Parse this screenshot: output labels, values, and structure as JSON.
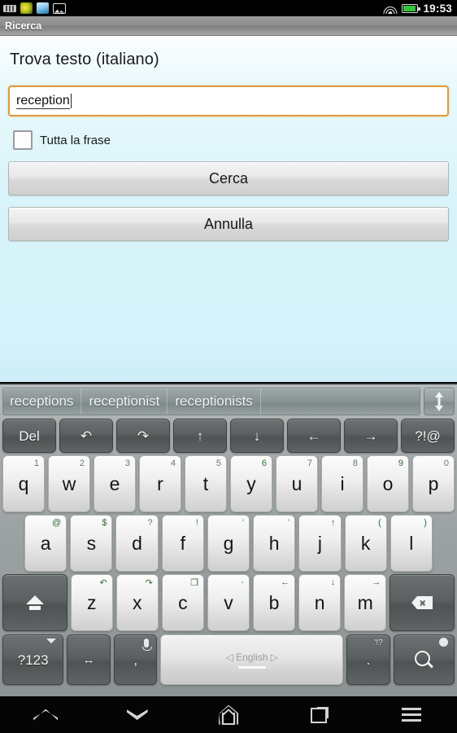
{
  "statusbar": {
    "icons": [
      "keyboard-icon",
      "app-yellow-icon",
      "app-blue-icon",
      "picture-icon"
    ],
    "wifi": "wifi-icon",
    "battery": "battery-icon",
    "time": "19:53"
  },
  "titlebar": {
    "title": "Ricerca"
  },
  "dialog": {
    "heading": "Trova testo (italiano)",
    "search_input": {
      "value": "reception",
      "placeholder": ""
    },
    "checkbox": {
      "label": "Tutta la frase",
      "checked": false
    },
    "search_button": "Cerca",
    "cancel_button": "Annulla"
  },
  "keyboard": {
    "suggestions": [
      "receptions",
      "receptionist",
      "receptionists"
    ],
    "expand_icon": "up-down-arrow-icon",
    "function_row": [
      {
        "label": "Del",
        "icon": ""
      },
      {
        "label": "↶",
        "icon": "undo-icon"
      },
      {
        "label": "↷",
        "icon": "redo-icon"
      },
      {
        "label": "↑",
        "icon": "arrow-up-icon"
      },
      {
        "label": "↓",
        "icon": "arrow-down-icon"
      },
      {
        "label": "←",
        "icon": "arrow-left-icon"
      },
      {
        "label": "→",
        "icon": "arrow-right-icon"
      },
      {
        "label": "?!@",
        "icon": ""
      }
    ],
    "row1": [
      {
        "key": "q",
        "alt": "1"
      },
      {
        "key": "w",
        "alt": "2"
      },
      {
        "key": "e",
        "alt": "3"
      },
      {
        "key": "r",
        "alt": "4"
      },
      {
        "key": "t",
        "alt": "5"
      },
      {
        "key": "y",
        "alt": "6"
      },
      {
        "key": "u",
        "alt": "7"
      },
      {
        "key": "i",
        "alt": "8"
      },
      {
        "key": "o",
        "alt": "9"
      },
      {
        "key": "p",
        "alt": "0"
      }
    ],
    "row2": [
      {
        "key": "a",
        "alt": "@"
      },
      {
        "key": "s",
        "alt": "$"
      },
      {
        "key": "d",
        "alt": "?"
      },
      {
        "key": "f",
        "alt": "!"
      },
      {
        "key": "g",
        "alt": "'"
      },
      {
        "key": "h",
        "alt": "’"
      },
      {
        "key": "j",
        "alt": "↑"
      },
      {
        "key": "k",
        "alt": "("
      },
      {
        "key": "l",
        "alt": ")"
      }
    ],
    "row3": [
      {
        "key": "z",
        "alt": "↶"
      },
      {
        "key": "x",
        "alt": "↷"
      },
      {
        "key": "c",
        "alt": "❐"
      },
      {
        "key": "v",
        "alt": "-"
      },
      {
        "key": "b",
        "alt": "←"
      },
      {
        "key": "n",
        "alt": "↓"
      },
      {
        "key": "m",
        "alt": "→"
      }
    ],
    "shift": "shift-icon",
    "backspace": "backspace-icon",
    "bottom_row": {
      "symbols": "?123",
      "move": "move-cursor-icon",
      "comma": ",",
      "comma_alt": "mic-icon",
      "space_label": "◁  English  ▷",
      "period": ".",
      "period_alt": "'!?",
      "search": "search-icon"
    }
  },
  "navbar": {
    "items": [
      "back-icon",
      "hide-keyboard-icon",
      "home-icon",
      "recent-apps-icon",
      "menu-icon"
    ]
  }
}
